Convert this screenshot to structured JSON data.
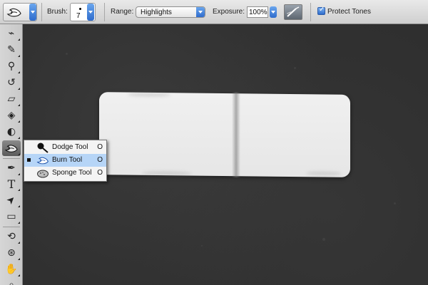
{
  "options_bar": {
    "tool_preset_icon": "burn-tool-icon",
    "brush_label": "Brush:",
    "brush_size": "7",
    "range_label": "Range:",
    "range_value": "Highlights",
    "exposure_label": "Exposure:",
    "exposure_value": "100%",
    "airbrush_icon": "airbrush-icon",
    "protect_tones_label": "Protect Tones",
    "protect_tones_checked": true
  },
  "tools": [
    {
      "name": "healing-brush-tool",
      "icon": "bandage-icon",
      "glyph": "⌁"
    },
    {
      "name": "brush-tool",
      "icon": "brush-icon",
      "glyph": "✎"
    },
    {
      "name": "clone-stamp-tool",
      "icon": "stamp-icon",
      "glyph": "⚲"
    },
    {
      "name": "history-brush-tool",
      "icon": "history-brush-icon",
      "glyph": "↺"
    },
    {
      "name": "eraser-tool",
      "icon": "eraser-icon",
      "glyph": "▱"
    },
    {
      "name": "paint-bucket-tool",
      "icon": "paint-bucket-icon",
      "glyph": "◈"
    },
    {
      "name": "blur-tool",
      "icon": "blur-drop-icon",
      "glyph": "◐"
    },
    {
      "name": "burn-tool",
      "icon": "burn-tool-icon",
      "glyph": "◔"
    },
    {
      "name": "pen-tool",
      "icon": "pen-icon",
      "glyph": "✒"
    },
    {
      "name": "type-tool",
      "icon": "type-icon",
      "glyph": "T"
    },
    {
      "name": "path-selection-tool",
      "icon": "arrow-icon",
      "glyph": "➤"
    },
    {
      "name": "shape-tool",
      "icon": "rounded-rect-icon",
      "glyph": "▭"
    },
    {
      "name": "3d-rotate-tool",
      "icon": "3d-rotate-icon",
      "glyph": "⟲"
    },
    {
      "name": "3d-orbit-tool",
      "icon": "3d-orbit-icon",
      "glyph": "⊛"
    },
    {
      "name": "hand-tool",
      "icon": "hand-icon",
      "glyph": "✋"
    },
    {
      "name": "zoom-tool",
      "icon": "zoom-icon",
      "glyph": "⌕"
    }
  ],
  "flyout": {
    "items": [
      {
        "label": "Dodge Tool",
        "shortcut": "O",
        "icon": "dodge-icon",
        "selected": false
      },
      {
        "label": "Burn Tool",
        "shortcut": "O",
        "icon": "burn-tool-icon",
        "selected": true
      },
      {
        "label": "Sponge Tool",
        "shortcut": "O",
        "icon": "sponge-icon",
        "selected": false
      }
    ]
  },
  "colors": {
    "accent_blue": "#2f6ccc",
    "selection_highlight": "#b6d5f7",
    "canvas_background": "#2f2f2f",
    "label_fill": "#ececec"
  }
}
